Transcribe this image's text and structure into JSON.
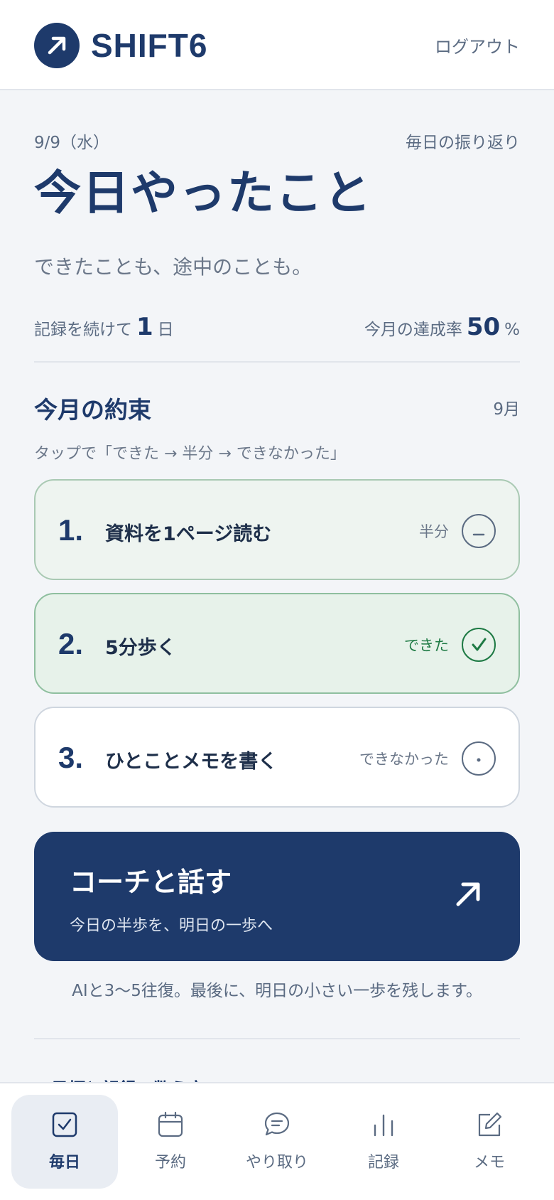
{
  "header": {
    "logo_text": "SHIFT6",
    "logout_label": "ログアウト"
  },
  "intro": {
    "date": "9/9（水）",
    "review_label": "毎日の振り返り",
    "title": "今日やったこと",
    "subtitle": "できたことも、途中のことも。",
    "streak_prefix": "記録を続けて",
    "streak_value": "1",
    "streak_unit": "日",
    "rate_label": "今月の達成率",
    "rate_value": "50",
    "rate_unit": "%"
  },
  "promises": {
    "title": "今月の約束",
    "month": "9月",
    "hint": "タップで「できた → 半分 → できなかった」",
    "items": [
      {
        "index": "1.",
        "label": "資料を1ページ読む",
        "status": "半分",
        "state": "half"
      },
      {
        "index": "2.",
        "label": "5分歩く",
        "status": "できた",
        "state": "done"
      },
      {
        "index": "3.",
        "label": "ひとことメモを書く",
        "status": "できなかった",
        "state": "not-done"
      }
    ]
  },
  "coach": {
    "title": "コーチと話す",
    "subtitle": "今日の半歩を、明日の一歩へ",
    "note": "AIと3〜5往復。最後に、明日の小さい一歩を残します。"
  },
  "peek_text": "目標と記録の数え方",
  "tabs": [
    {
      "label": "毎日",
      "icon": "checkbox-icon",
      "active": true
    },
    {
      "label": "予約",
      "icon": "calendar-icon",
      "active": false
    },
    {
      "label": "やり取り",
      "icon": "chat-bubble-icon",
      "active": false
    },
    {
      "label": "記録",
      "icon": "bar-chart-icon",
      "active": false
    },
    {
      "label": "メモ",
      "icon": "edit-note-icon",
      "active": false
    }
  ],
  "colors": {
    "brand": "#1e3a6b",
    "background": "#f3f5f8",
    "done_green": "#1e7a44"
  }
}
